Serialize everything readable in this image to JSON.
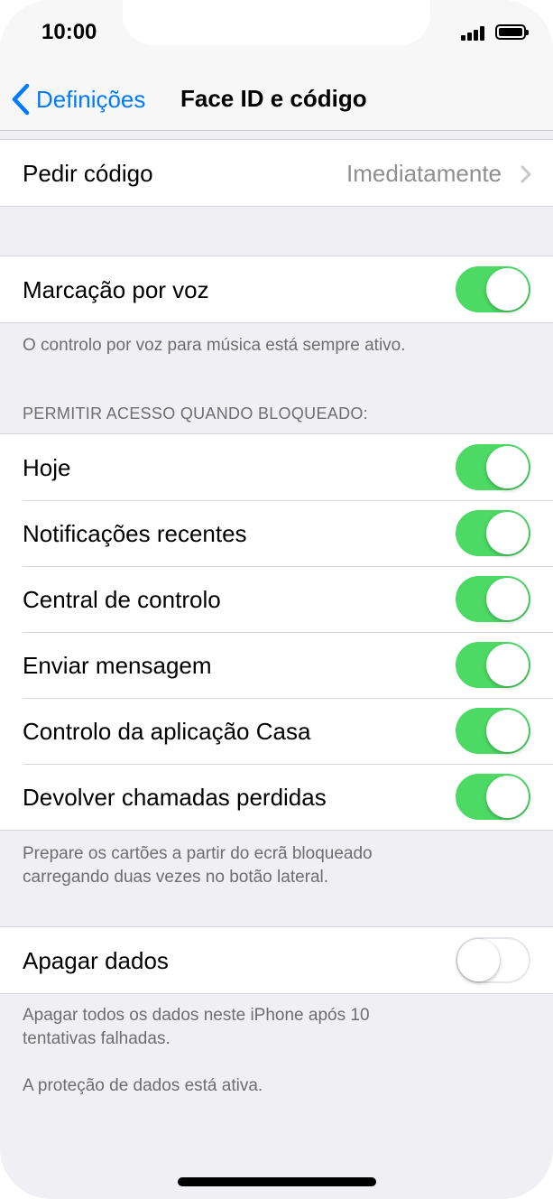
{
  "status_bar": {
    "time": "10:00",
    "signal_icon": "cellular-signal-icon",
    "battery_icon": "battery-full-icon"
  },
  "nav": {
    "back_label": "Definições",
    "title": "Face ID e código",
    "back_icon": "chevron-left-icon"
  },
  "require_passcode": {
    "label": "Pedir código",
    "value": "Imediatamente",
    "chevron_icon": "chevron-right-icon"
  },
  "voice_dial": {
    "label": "Marcação por voz",
    "on": true,
    "footer": "O controlo por voz para música está sempre ativo."
  },
  "locked_access": {
    "header": "PERMITIR ACESSO QUANDO BLOQUEADO:",
    "items": [
      {
        "label": "Hoje",
        "on": true
      },
      {
        "label": "Notificações recentes",
        "on": true
      },
      {
        "label": "Central de controlo",
        "on": true
      },
      {
        "label": "Enviar mensagem",
        "on": true
      },
      {
        "label": "Controlo da aplicação Casa",
        "on": true
      },
      {
        "label": "Devolver chamadas perdidas",
        "on": true
      }
    ],
    "footer_line1": "Prepare os cartões a partir do ecrã bloqueado",
    "footer_line2": "carregando duas vezes no botão lateral."
  },
  "erase_data": {
    "label": "Apagar dados",
    "on": false,
    "footer_line1": "Apagar todos os dados neste iPhone após 10",
    "footer_line2": "tentativas falhadas.",
    "footer_note": "A proteção de dados está ativa."
  },
  "colors": {
    "accent": "#007aff",
    "toggle_on": "#4cd964",
    "background": "#efeff4",
    "secondary_text": "#6d6d72"
  }
}
